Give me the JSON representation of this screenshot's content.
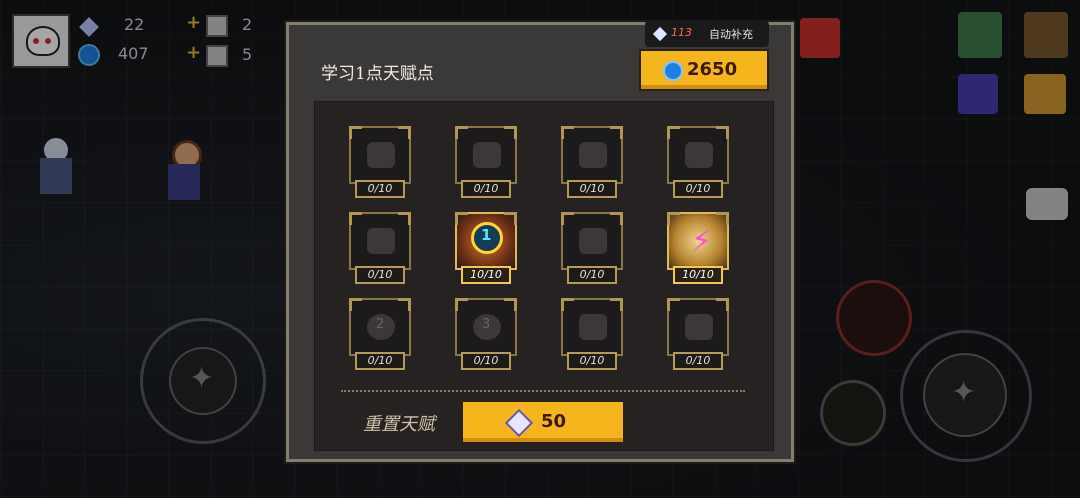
{
  "hud": {
    "gems": "22",
    "coins": "407",
    "item_a_count": "2",
    "item_b_count": "5"
  },
  "panel": {
    "title": "学习1点天赋点",
    "gem_count": "113",
    "auto_refill_label": "自动补充",
    "coin_cost": "2650",
    "reset_label": "重置天赋",
    "reset_cost": "50"
  },
  "talents": [
    {
      "label": "0/10",
      "icon": "heart-icon"
    },
    {
      "label": "0/10",
      "icon": "sword-icon"
    },
    {
      "label": "0/10",
      "icon": "swirl-icon"
    },
    {
      "label": "0/10",
      "icon": "drop-icon"
    },
    {
      "label": "0/10",
      "icon": "bomb-icon"
    },
    {
      "label": "10/10",
      "icon": "numbered-ring-1-icon",
      "ring_number": "1"
    },
    {
      "label": "0/10",
      "icon": "shield-icon"
    },
    {
      "label": "10/10",
      "icon": "lightning-bolt-icon",
      "symbol": "⚡"
    },
    {
      "label": "0/10",
      "icon": "numbered-ring-2-icon",
      "ring_number": "2"
    },
    {
      "label": "0/10",
      "icon": "numbered-ring-3-icon",
      "ring_number": "3"
    },
    {
      "label": "0/10",
      "icon": "skull-icon"
    },
    {
      "label": "0/10",
      "icon": "eye-icon"
    }
  ],
  "colors": {
    "accent_gold": "#f5b51c",
    "panel_bg": "#3b3838",
    "gem_red": "#ff6a4a"
  }
}
